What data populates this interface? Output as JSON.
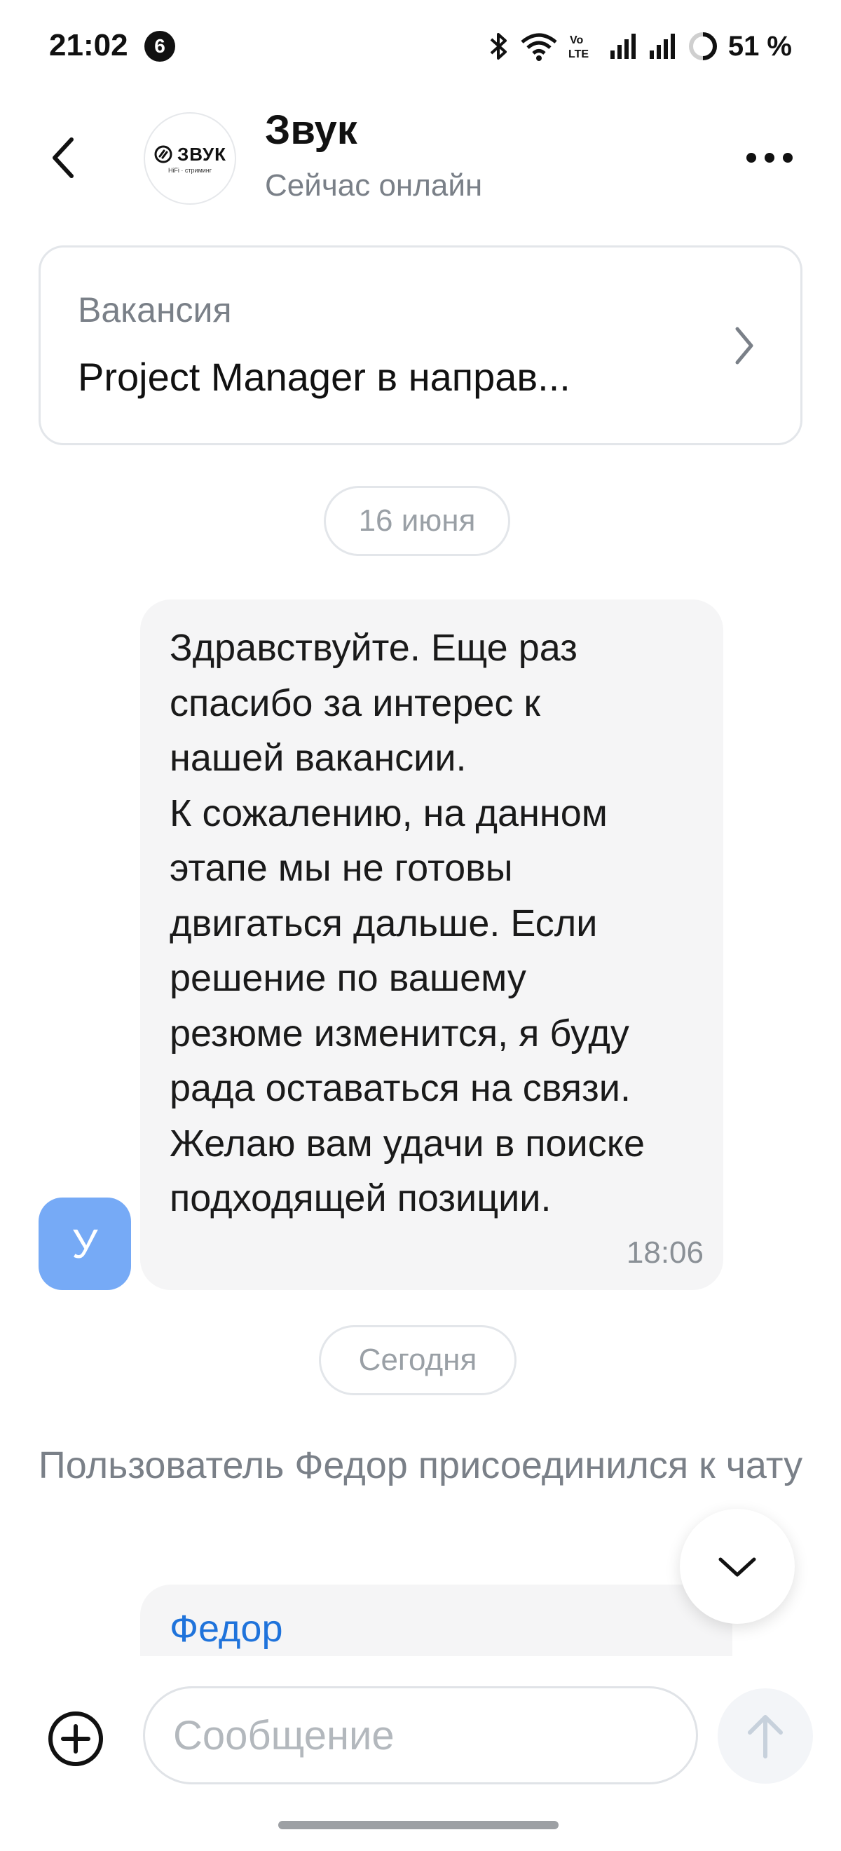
{
  "status_bar": {
    "time": "21:02",
    "notification_count": "6",
    "network_label": "Vo LTE",
    "battery": "51 %"
  },
  "header": {
    "logo_text": "ЗВУК",
    "logo_subtitle": "HiFi · стриминг",
    "title": "Звук",
    "status": "Сейчас онлайн"
  },
  "vacancy": {
    "label": "Вакансия",
    "value": "Project Manager в направ..."
  },
  "chat": {
    "date_1": "16 июня",
    "message_1": {
      "avatar_letter": "У",
      "text": "Здравствуйте. Еще раз\nспасибо за интерес к\nнашей вакансии.\nК сожалению, на данном\nэтапе мы не готовы\nдвигаться дальше. Если\nрешение по вашему\nрезюме изменится, я буду\nрада оставаться на связи.\nЖелаю вам удачи в поиске\nподходящей позиции.",
      "time": "18:06"
    },
    "date_2": "Сегодня",
    "system_message": "Пользователь Федор присоединился к чату",
    "message_2": {
      "author": "Федор"
    }
  },
  "composer": {
    "placeholder": "Сообщение"
  },
  "colors": {
    "accent_blue": "#1f73db",
    "avatar_blue": "#76aaf6",
    "bubble_bg": "#f5f5f6",
    "muted_text": "#7a8088"
  }
}
